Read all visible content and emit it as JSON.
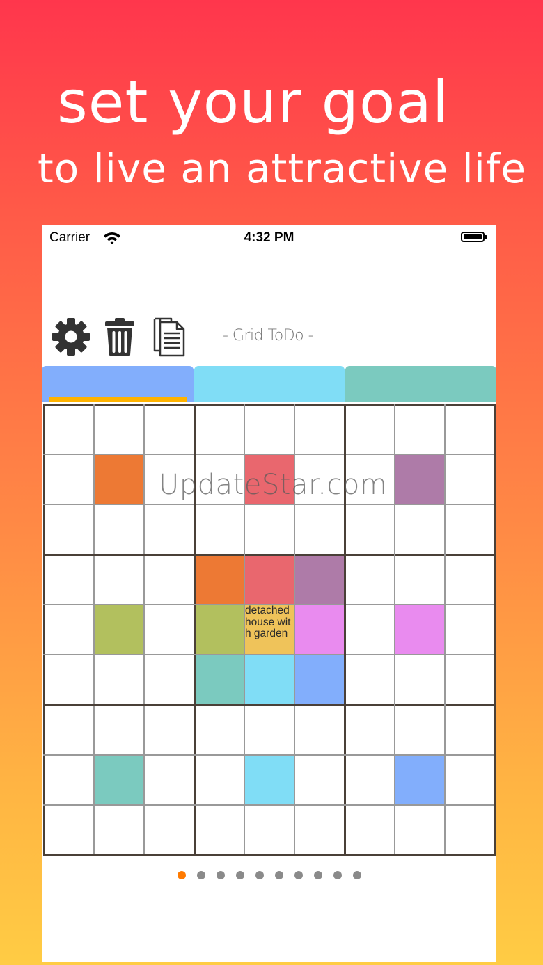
{
  "promo": {
    "headline": "set your goal",
    "subheadline": "to live an attractive life"
  },
  "status_bar": {
    "carrier": "Carrier",
    "time": "4:32 PM",
    "wifi_icon": "wifi-icon",
    "battery_icon": "battery-icon"
  },
  "toolbar": {
    "settings_icon": "gear-icon",
    "delete_icon": "trash-icon",
    "copy_icon": "document-copy-icon",
    "title": "- Grid ToDo -"
  },
  "tabs": [
    {
      "color": "#82aefc",
      "selected": true
    },
    {
      "color": "#80ddf6",
      "selected": false
    },
    {
      "color": "#7bcabf",
      "selected": false
    }
  ],
  "tab_indicator_color": "#ffb300",
  "grid": {
    "rows": 9,
    "cols": 9,
    "filled_cells": [
      {
        "row": 1,
        "col": 1,
        "color": "#ed7934"
      },
      {
        "row": 1,
        "col": 4,
        "color": "#e9676e"
      },
      {
        "row": 1,
        "col": 7,
        "color": "#ae7ba8"
      },
      {
        "row": 3,
        "col": 3,
        "color": "#ed7934"
      },
      {
        "row": 3,
        "col": 4,
        "color": "#e9676e"
      },
      {
        "row": 3,
        "col": 5,
        "color": "#ae7ba8"
      },
      {
        "row": 4,
        "col": 1,
        "color": "#b2c05e"
      },
      {
        "row": 4,
        "col": 3,
        "color": "#b2c05e"
      },
      {
        "row": 4,
        "col": 4,
        "color": "#efc35a",
        "text": "detached house with garden"
      },
      {
        "row": 4,
        "col": 5,
        "color": "#e98bef"
      },
      {
        "row": 4,
        "col": 7,
        "color": "#e98bef"
      },
      {
        "row": 5,
        "col": 3,
        "color": "#7bcabf"
      },
      {
        "row": 5,
        "col": 4,
        "color": "#80ddf6"
      },
      {
        "row": 5,
        "col": 5,
        "color": "#82aefc"
      },
      {
        "row": 7,
        "col": 1,
        "color": "#7bcabf"
      },
      {
        "row": 7,
        "col": 4,
        "color": "#80ddf6"
      },
      {
        "row": 7,
        "col": 7,
        "color": "#82aefc"
      }
    ]
  },
  "pager": {
    "count": 10,
    "active_index": 0
  },
  "watermark": "UpdateStar.com"
}
